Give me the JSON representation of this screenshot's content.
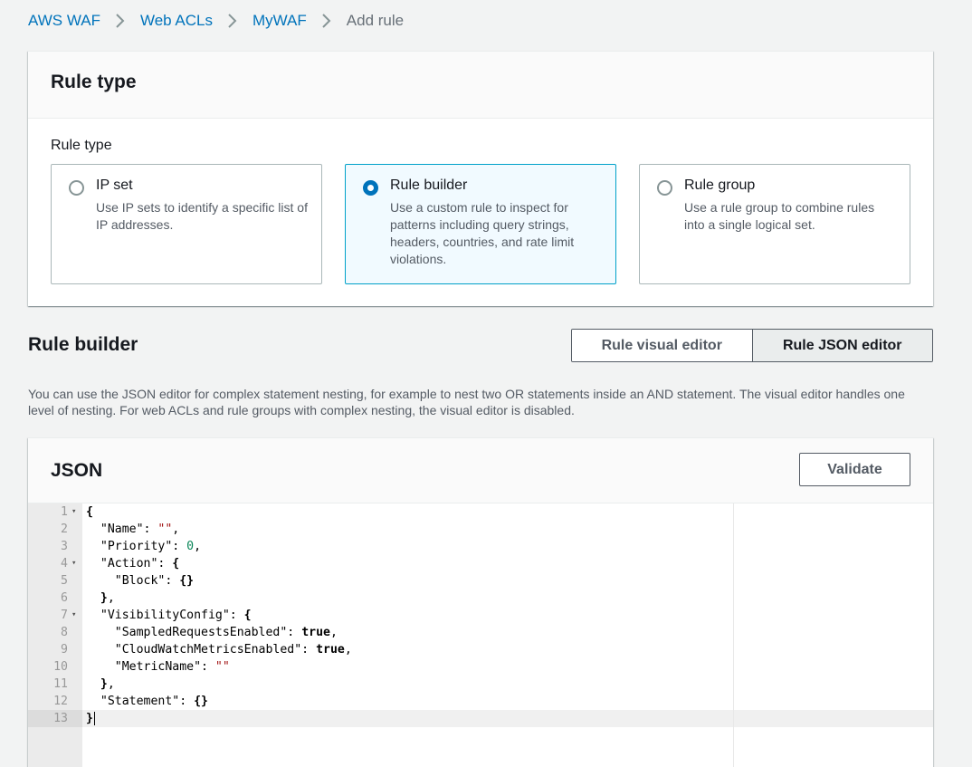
{
  "breadcrumb": {
    "items": [
      "AWS WAF",
      "Web ACLs",
      "MyWAF"
    ],
    "current": "Add rule"
  },
  "rule_type_panel": {
    "title": "Rule type",
    "field_label": "Rule type",
    "options": [
      {
        "title": "IP set",
        "description": "Use IP sets to identify a specific list of IP addresses.",
        "selected": false
      },
      {
        "title": "Rule builder",
        "description": "Use a custom rule to inspect for patterns including query strings, headers, countries, and rate limit violations.",
        "selected": true
      },
      {
        "title": "Rule group",
        "description": "Use a rule group to combine rules into a single logical set.",
        "selected": false
      }
    ]
  },
  "rule_builder": {
    "title": "Rule builder",
    "visual_editor_label": "Rule visual editor",
    "json_editor_label": "Rule JSON editor",
    "active_editor": "Rule JSON editor",
    "info_text": "You can use the JSON editor for complex statement nesting, for example to nest two OR statements inside an AND statement. The visual editor handles one level of nesting. For web ACLs and rule groups with complex nesting, the visual editor is disabled."
  },
  "json_panel": {
    "title": "JSON",
    "validate_label": "Validate",
    "active_line": 13,
    "lines": [
      {
        "n": "1",
        "fold": true,
        "code": "{"
      },
      {
        "n": "2",
        "fold": false,
        "code": "  \"Name\": \"\","
      },
      {
        "n": "3",
        "fold": false,
        "code": "  \"Priority\": 0,"
      },
      {
        "n": "4",
        "fold": true,
        "code": "  \"Action\": {"
      },
      {
        "n": "5",
        "fold": false,
        "code": "    \"Block\": {}"
      },
      {
        "n": "6",
        "fold": false,
        "code": "  },"
      },
      {
        "n": "7",
        "fold": true,
        "code": "  \"VisibilityConfig\": {"
      },
      {
        "n": "8",
        "fold": false,
        "code": "    \"SampledRequestsEnabled\": true,"
      },
      {
        "n": "9",
        "fold": false,
        "code": "    \"CloudWatchMetricsEnabled\": true,"
      },
      {
        "n": "10",
        "fold": false,
        "code": "    \"MetricName\": \"\""
      },
      {
        "n": "11",
        "fold": false,
        "code": "  },"
      },
      {
        "n": "12",
        "fold": false,
        "code": "  \"Statement\": {}"
      },
      {
        "n": "13",
        "fold": false,
        "code": "}"
      }
    ]
  },
  "icons": {
    "breadcrumb_separator": "chevron-right-icon",
    "fold_marker": "caret-down-icon"
  },
  "colors": {
    "link": "#0073bb",
    "selected_tile_border": "#00a1c9",
    "selected_tile_bg": "#f1faff"
  }
}
